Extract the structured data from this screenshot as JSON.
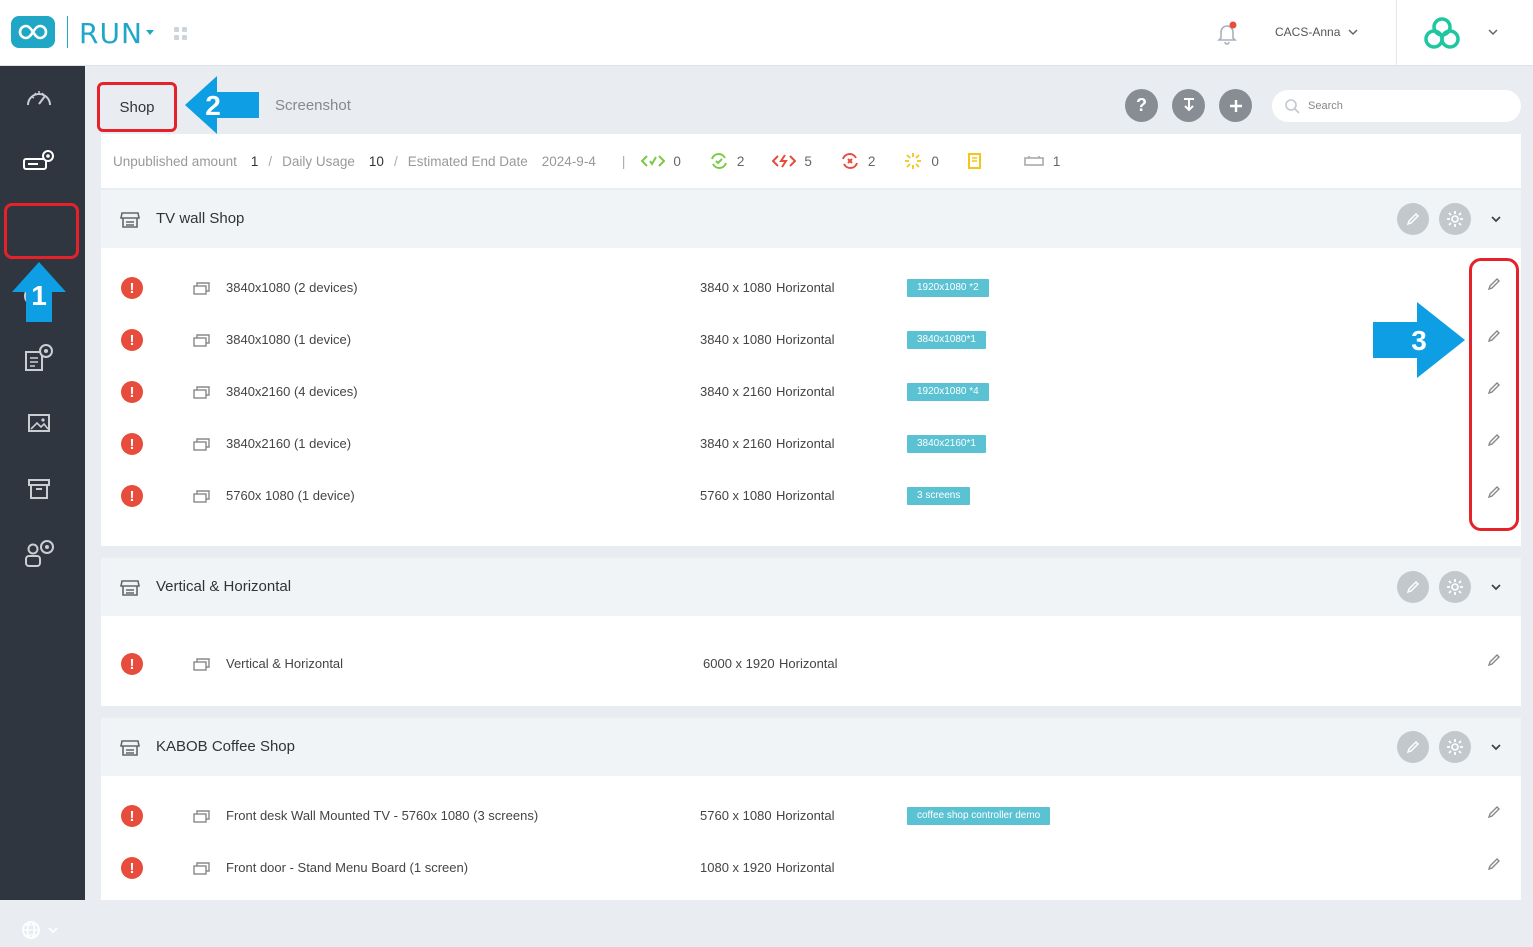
{
  "header": {
    "brand": "RUN",
    "user_name": "CACS-Anna"
  },
  "tabs": [
    {
      "label": "Shop"
    },
    {
      "label": "Screenshot"
    }
  ],
  "toolbar": {
    "help_label": "?",
    "search_placeholder": "Search"
  },
  "stats": {
    "unpublished_label": "Unpublished amount",
    "unpublished_value": "1",
    "daily_usage_label": "Daily Usage",
    "daily_usage_value": "10",
    "end_date_label": "Estimated End Date",
    "end_date_value": "2024-9-4",
    "counters": [
      {
        "icon": "online-icon",
        "value": "0",
        "color": "#7ac943"
      },
      {
        "icon": "synced-icon",
        "value": "2",
        "color": "#7ac943"
      },
      {
        "icon": "offline-icon",
        "value": "5",
        "color": "#e74c3c"
      },
      {
        "icon": "error-icon",
        "value": "2",
        "color": "#e74c3c"
      },
      {
        "icon": "loading-icon",
        "value": "0",
        "color": "#f5c518"
      },
      {
        "icon": "document-icon",
        "value": "",
        "color": "#f5c518"
      },
      {
        "icon": "screen-icon",
        "value": "1",
        "color": "#999999"
      }
    ]
  },
  "groups": [
    {
      "title": "TV wall Shop",
      "rows": [
        {
          "name": "3840x1080 (2 devices)",
          "resolution": "3840 x 1080",
          "orientation": "Horizontal",
          "tag": "1920x1080 *2"
        },
        {
          "name": "3840x1080 (1 device)",
          "resolution": "3840 x 1080",
          "orientation": "Horizontal",
          "tag": "3840x1080*1"
        },
        {
          "name": "3840x2160 (4 devices)",
          "resolution": "3840 x 2160",
          "orientation": "Horizontal",
          "tag": "1920x1080 *4"
        },
        {
          "name": "3840x2160 (1 device)",
          "resolution": "3840 x 2160",
          "orientation": "Horizontal",
          "tag": "3840x2160*1"
        },
        {
          "name": "5760x 1080 (1 device)",
          "resolution": "5760 x 1080",
          "orientation": "Horizontal",
          "tag": "3 screens"
        }
      ]
    },
    {
      "title": "Vertical & Horizontal",
      "rows": [
        {
          "name": "Vertical & Horizontal",
          "resolution": "6000 x 1920",
          "orientation": "Horizontal",
          "tag": ""
        }
      ]
    },
    {
      "title": "KABOB Coffee Shop",
      "rows": [
        {
          "name": "Front desk Wall Mounted TV - 5760x 1080 (3 screens)",
          "resolution": "5760 x 1080",
          "orientation": "Horizontal",
          "tag": "coffee shop controller demo"
        },
        {
          "name": "Front door - Stand Menu Board (1 screen)",
          "resolution": "1080 x 1920",
          "orientation": "Horizontal",
          "tag": ""
        }
      ]
    }
  ],
  "annotations": {
    "step1": "1",
    "step2": "2",
    "step3": "3",
    "highlight_color": "#e5212a",
    "arrow_color": "#0d9ee3"
  },
  "colors": {
    "brand": "#1fa7c5",
    "sidebar": "#2f3640",
    "error": "#e74c3c",
    "tag": "#5bc2d4"
  }
}
